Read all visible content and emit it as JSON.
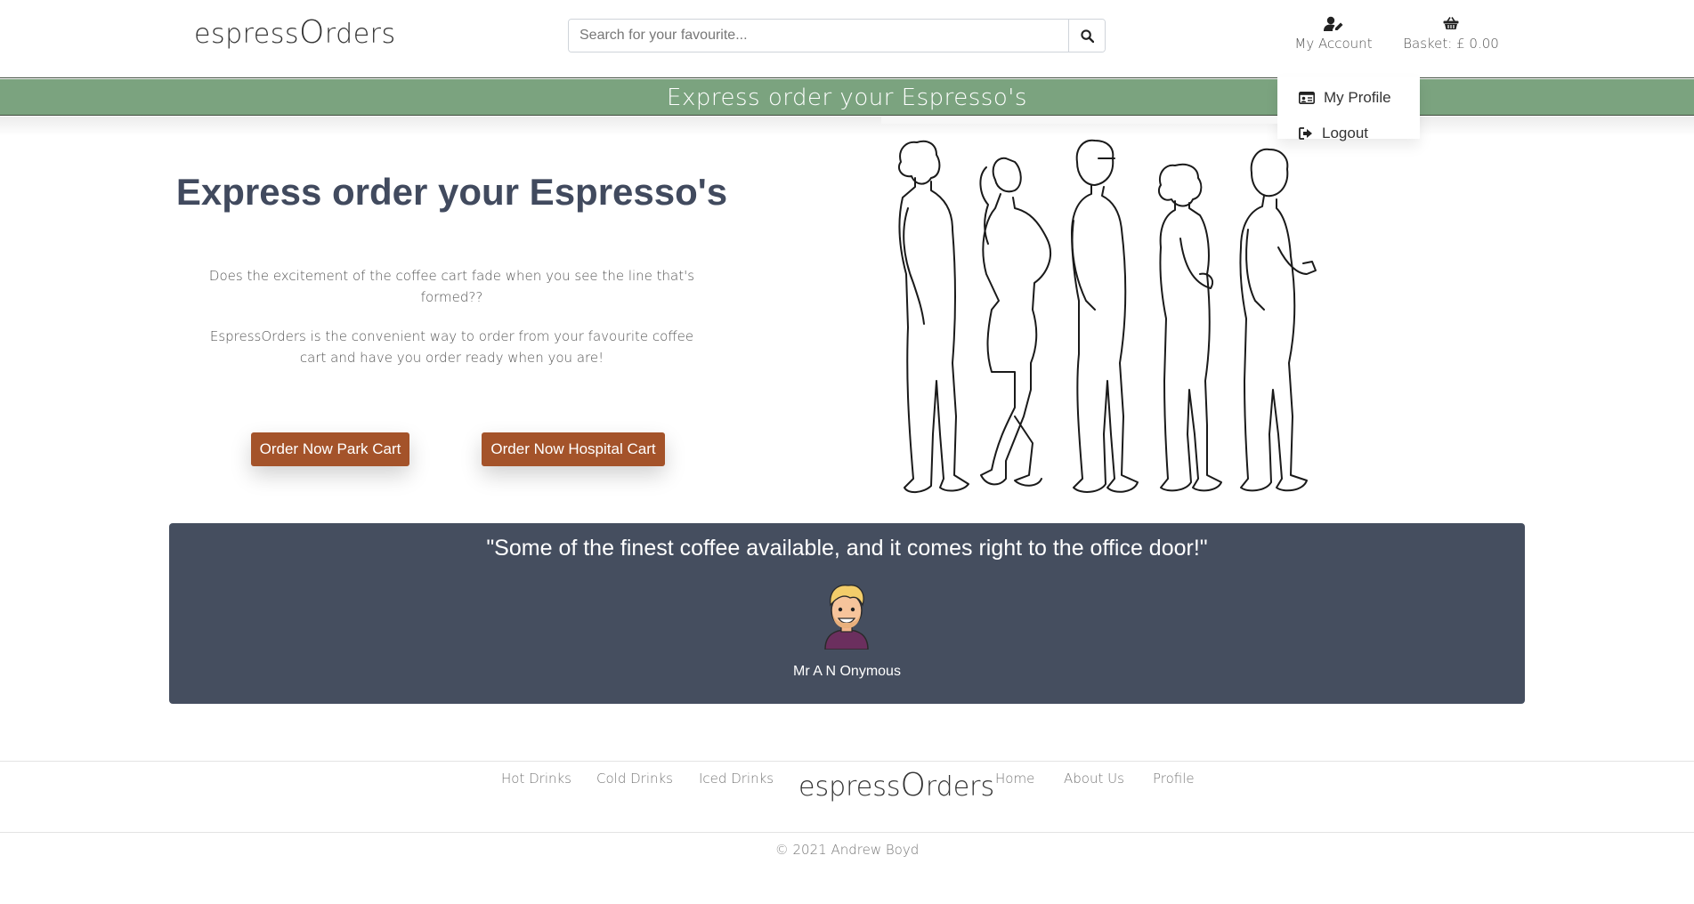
{
  "header": {
    "logo_prefix": "espress",
    "logo_o": "O",
    "logo_suffix": "rders",
    "search_placeholder": "Search for your favourite...",
    "account_label": "My Account",
    "basket_label": "Basket: £ 0.00"
  },
  "banner": {
    "text": "Express order your Espresso's"
  },
  "account_menu": {
    "items": [
      {
        "label": "My Profile",
        "icon": "id-card-icon"
      },
      {
        "label": "Logout",
        "icon": "sign-out-icon"
      }
    ]
  },
  "hero": {
    "title": "Express order your Espresso's",
    "paragraph1": "Does the excitement of the coffee cart fade when you see the line that's formed??",
    "paragraph2": "EspressOrders is the convenient way to order from your favourite coffee cart and have you order ready when you are!",
    "button_park": "Order Now Park Cart",
    "button_hospital": "Order Now Hospital Cart"
  },
  "testimonial": {
    "quote": "\"Some of the finest coffee available, and it comes right to the office door!\"",
    "author": "Mr A N Onymous"
  },
  "footer": {
    "links_left": [
      "Hot Drinks",
      "Cold Drinks",
      "Iced Drinks"
    ],
    "links_right": [
      "Home",
      "About Us",
      "Profile"
    ],
    "logo_prefix": "espress",
    "logo_o": "O",
    "logo_suffix": "rders",
    "copyright": "© 2021 Andrew Boyd"
  },
  "colors": {
    "banner": "#7ba37f",
    "button": "#a4532a",
    "testimonial_bg": "#454e5f",
    "title": "#414a5e"
  }
}
